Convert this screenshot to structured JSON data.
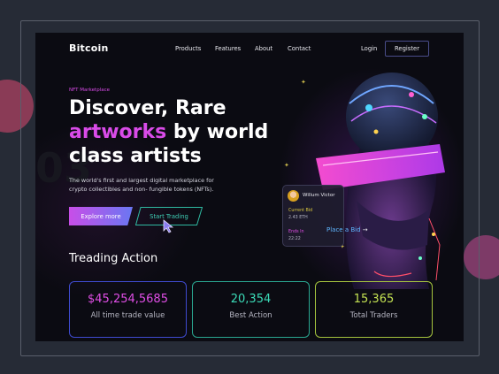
{
  "nav": {
    "logo": "Bitcoin",
    "links": [
      "Products",
      "Features",
      "About",
      "Contact"
    ],
    "login": "Login",
    "register": "Register"
  },
  "hero": {
    "eyebrow": "NFT Marketplace",
    "headline_part1": "Discover, Rare",
    "headline_accent": "artworks",
    "headline_part2": "by world class artists",
    "bg_number": "03",
    "description": "The world's first and largest digital marketplace for crypto collectibles and non- fungible tokens (NFTs).",
    "primary_button": "Explore more",
    "secondary_button": "Start Trading"
  },
  "bid_card": {
    "name": "Willum Victor",
    "current_bid_label": "Current Bid",
    "current_bid_value": "2.43 ETH",
    "ends_label": "Ends In",
    "ends_value": "22:22",
    "place_bid": "Place a Bid",
    "place_bid_arrow": "→"
  },
  "stats": {
    "title": "Treading Action",
    "items": [
      {
        "value": "$45,254,5685",
        "label": "All time trade value"
      },
      {
        "value": "20,354",
        "label": "Best Action"
      },
      {
        "value": "15,365",
        "label": "Total Traders"
      }
    ]
  },
  "colors": {
    "accent_magenta": "#d94be8",
    "accent_teal": "#3bdcb8",
    "accent_lime": "#c4e253",
    "accent_blue": "#3f4bd0",
    "background": "#0b0b12"
  }
}
